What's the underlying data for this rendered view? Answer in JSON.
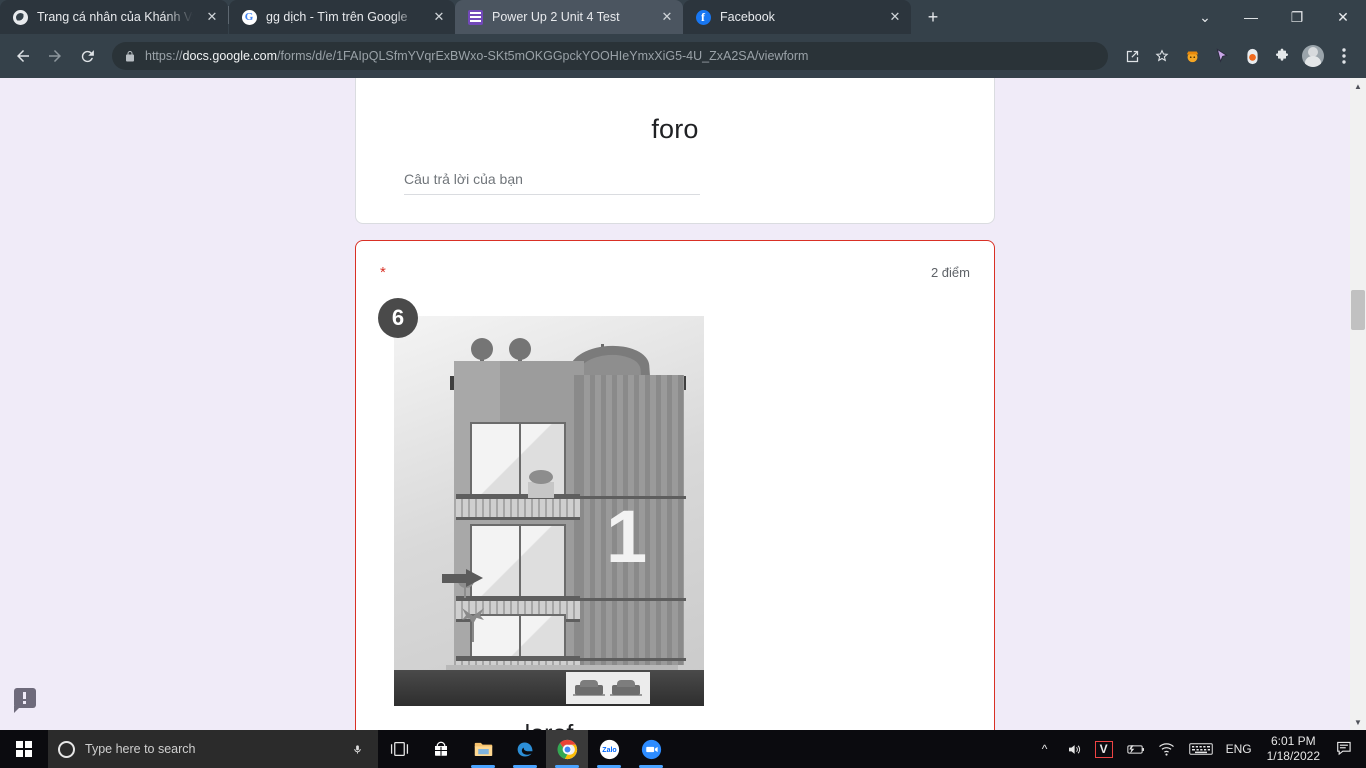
{
  "browser": {
    "tabs": [
      {
        "title": "Trang cá nhân của Khánh Vy Phư",
        "favicon": "globe-icon",
        "active": false
      },
      {
        "title": "gg dịch - Tìm trên Google",
        "favicon": "google-icon",
        "active": false
      },
      {
        "title": "Power Up 2 Unit 4 Test",
        "favicon": "google-forms-icon",
        "active": true
      },
      {
        "title": "Facebook",
        "favicon": "facebook-icon",
        "active": false
      }
    ],
    "new_tab_label": "+",
    "window_controls": {
      "expand": "⌄",
      "minimize": "—",
      "maximize": "❐",
      "close": "✕"
    },
    "nav": {
      "back": "←",
      "forward": "→",
      "reload": "⟳"
    },
    "omnibox": {
      "lock_icon": "lock-icon",
      "scheme": "https://",
      "domain": "docs.google.com",
      "path": "/forms/d/e/1FAIpQLSfmYVqrExBWxo-SKt5mOKGGpckYOOHIeYmxXiG5-4U_ZxA2SA/viewform",
      "full_url": "https://docs.google.com/forms/d/e/1FAIpQLSfmYVqrExBWxo-SKt5mOKGGpckYOOHIeYmxXiG5-4U_ZxA2SA/viewform"
    },
    "actions": [
      "share-icon",
      "bookmark-star-icon",
      "extension-orange-icon",
      "extension-cursor-icon",
      "extension-pill-icon",
      "extensions-puzzle-icon",
      "profile-avatar",
      "chrome-menu-icon"
    ]
  },
  "page": {
    "background_color": "#f0ebf8",
    "question_previous": {
      "title_image_text": "foro",
      "answer_placeholder": "Câu trả lời của bạn",
      "answer_value": ""
    },
    "question_current": {
      "required_marker": "*",
      "points_label": "2 điểm",
      "image": {
        "badge_number": "6",
        "building_floor_label": "1",
        "alt": "grayscale illustration of a multi-storey apartment building with arrow pointing to a floor"
      },
      "caption_text": "lorof"
    },
    "feedback_button": "feedback-icon",
    "scrollbar": {
      "up_arrow": "▲",
      "down_arrow": "▼"
    }
  },
  "taskbar": {
    "start_label": "start-button",
    "search_placeholder": "Type here to search",
    "search_value": "",
    "mic_icon": "microphone-icon",
    "items": [
      {
        "name": "task-view-icon"
      },
      {
        "name": "microsoft-store-icon"
      },
      {
        "name": "file-explorer-icon"
      },
      {
        "name": "edge-icon"
      },
      {
        "name": "chrome-icon"
      },
      {
        "name": "zalo-icon",
        "label": "Zalo"
      },
      {
        "name": "zoom-icon"
      }
    ],
    "tray": {
      "show_hidden": "^",
      "volume": "volume-icon",
      "unikey": "V",
      "battery": "battery-charging-icon",
      "network": "wifi-icon",
      "keyboard": "keyboard-icon",
      "language": "ENG",
      "time": "6:01 PM",
      "date": "1/18/2022",
      "notifications": "notification-icon"
    }
  }
}
